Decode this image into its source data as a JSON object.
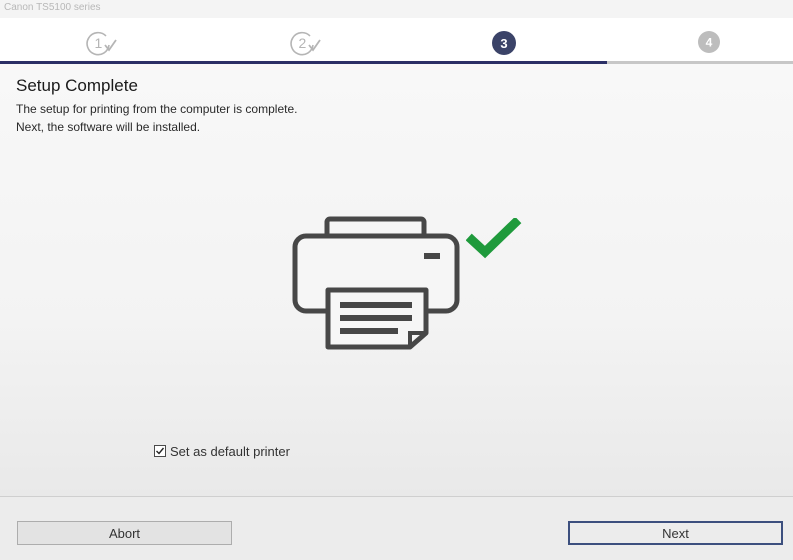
{
  "window": {
    "title": "Canon TS5100 series"
  },
  "steps": [
    {
      "label": "1",
      "state": "done"
    },
    {
      "label": "2",
      "state": "done"
    },
    {
      "label": "3",
      "state": "current"
    },
    {
      "label": "4",
      "state": "upcoming"
    }
  ],
  "progress": {
    "fraction": 0.765,
    "color": "#2b2f66"
  },
  "main": {
    "heading": "Setup Complete",
    "description_line1": "The setup for printing from the computer is complete.",
    "description_line2": "Next, the software will be installed.",
    "illustration_icons": [
      "printer-icon",
      "checkmark-icon"
    ],
    "checkmark_color": "#1f9a3c"
  },
  "options": {
    "default_printer_label": "Set as default printer",
    "default_printer_checked": true
  },
  "footer": {
    "abort_label": "Abort",
    "next_label": "Next"
  },
  "colors": {
    "accent": "#2b2f66",
    "step_done": "#b5b5b5",
    "step_upcoming": "#bdbdbd"
  }
}
